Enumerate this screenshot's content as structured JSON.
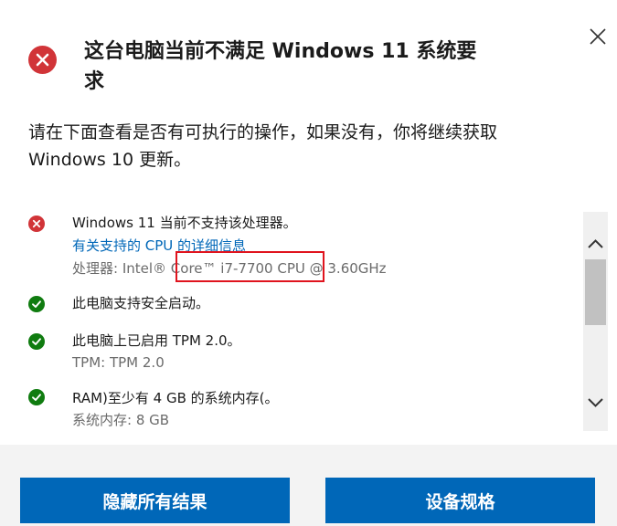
{
  "dialog": {
    "title": "这台电脑当前不满足 Windows 11 系统要求",
    "description": "请在下面查看是否有可执行的操作，如果没有，你将继续获取 Windows 10 更新。",
    "close_icon": "close-icon",
    "header_icon": "error-icon",
    "colors": {
      "error": "#d13438",
      "success": "#107c10",
      "accent": "#0067b8",
      "highlight": "#e0141e"
    }
  },
  "checks": [
    {
      "status": "fail",
      "icon": "error-icon",
      "title": "Windows 11 当前不支持该处理器。",
      "link": "有关支持的 CPU 的详细信息",
      "detail": "处理器: Intel® Core™ i7-7700 CPU @ 3.60GHz"
    },
    {
      "status": "pass",
      "icon": "check-icon",
      "title": "此电脑支持安全启动。"
    },
    {
      "status": "pass",
      "icon": "check-icon",
      "title": "此电脑上已启用 TPM 2.0。",
      "detail": "TPM: TPM 2.0"
    },
    {
      "status": "pass",
      "icon": "check-icon",
      "title": "RAM)至少有 4 GB 的系统内存(。",
      "detail": "系统内存: 8 GB"
    }
  ],
  "buttons": {
    "hide_all": "隐藏所有结果",
    "device_specs": "设备规格"
  }
}
